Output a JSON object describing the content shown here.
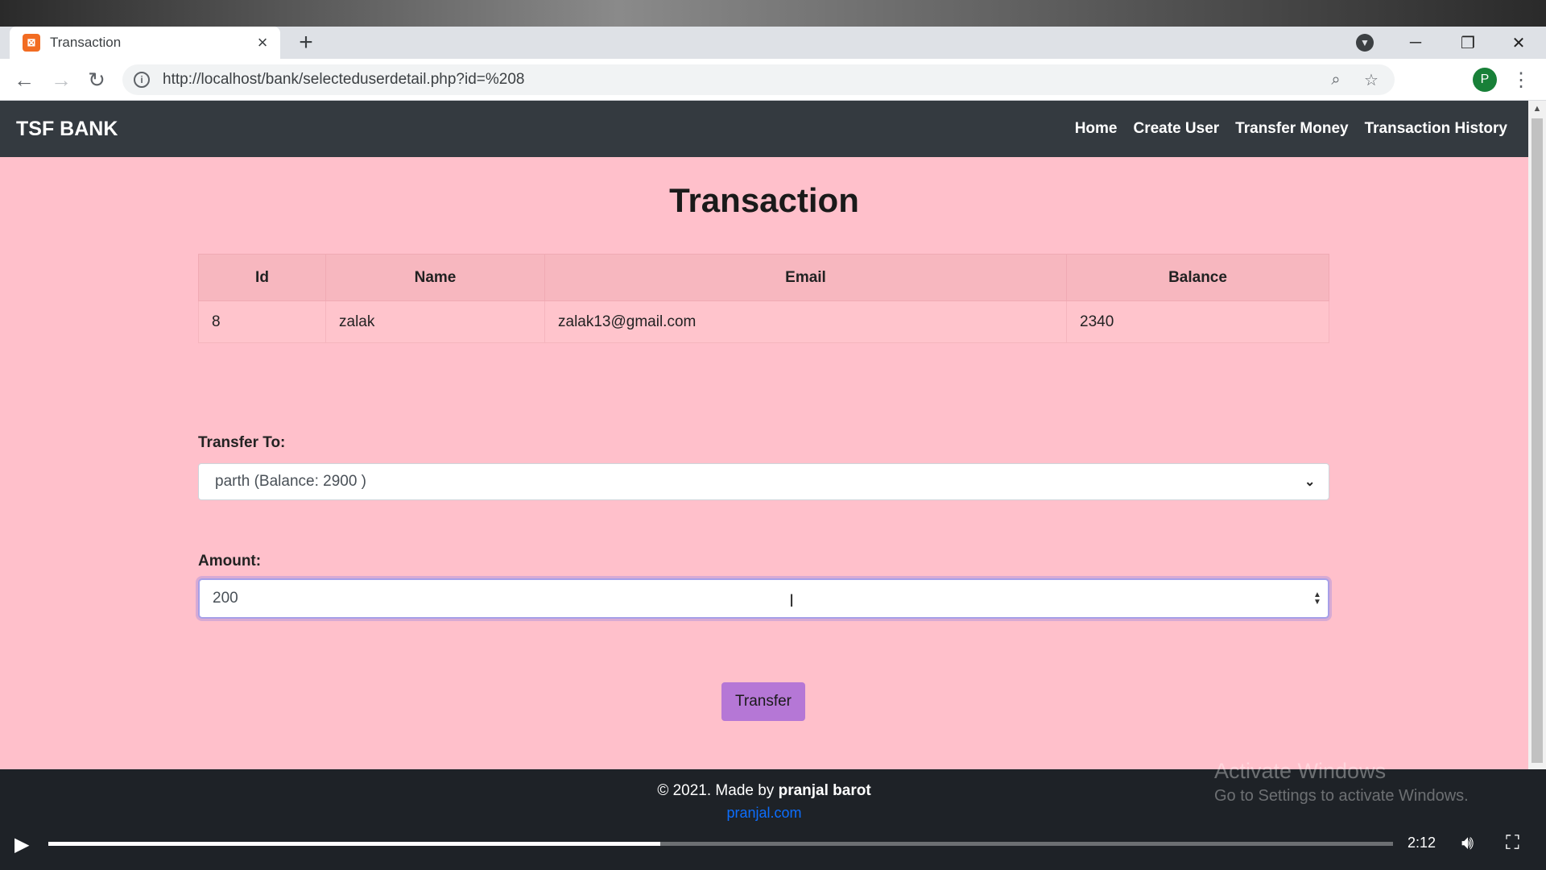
{
  "browser": {
    "tab_title": "Transaction",
    "tab_favicon": "xampp-icon",
    "url": "http://localhost/bank/selecteduserdetail.php?id=%208",
    "profile_initial": "P"
  },
  "navbar": {
    "brand": "TSF BANK",
    "links": [
      "Home",
      "Create User",
      "Transfer Money",
      "Transaction History"
    ]
  },
  "page": {
    "heading": "Transaction"
  },
  "table": {
    "headers": [
      "Id",
      "Name",
      "Email",
      "Balance"
    ],
    "row": [
      "8",
      "zalak",
      "zalak13@gmail.com",
      "2340"
    ]
  },
  "form": {
    "transfer_to_label": "Transfer To:",
    "transfer_to_value": "parth (Balance: 2900 )",
    "amount_label": "Amount:",
    "amount_value": "200",
    "submit_label": "Transfer"
  },
  "footer": {
    "copyright_prefix": "© 2021. Made by ",
    "author": "pranjal barot",
    "link": "pranjal.com"
  },
  "watermark": {
    "line1": "Activate Windows",
    "line2": "Go to Settings to activate Windows."
  },
  "video": {
    "time": "2:12",
    "progress": 0.455
  },
  "colors": {
    "page_bg": "#ffc0cb",
    "navbar_bg": "#343a40",
    "button_bg": "#b577d6",
    "link": "#0d6efd"
  }
}
